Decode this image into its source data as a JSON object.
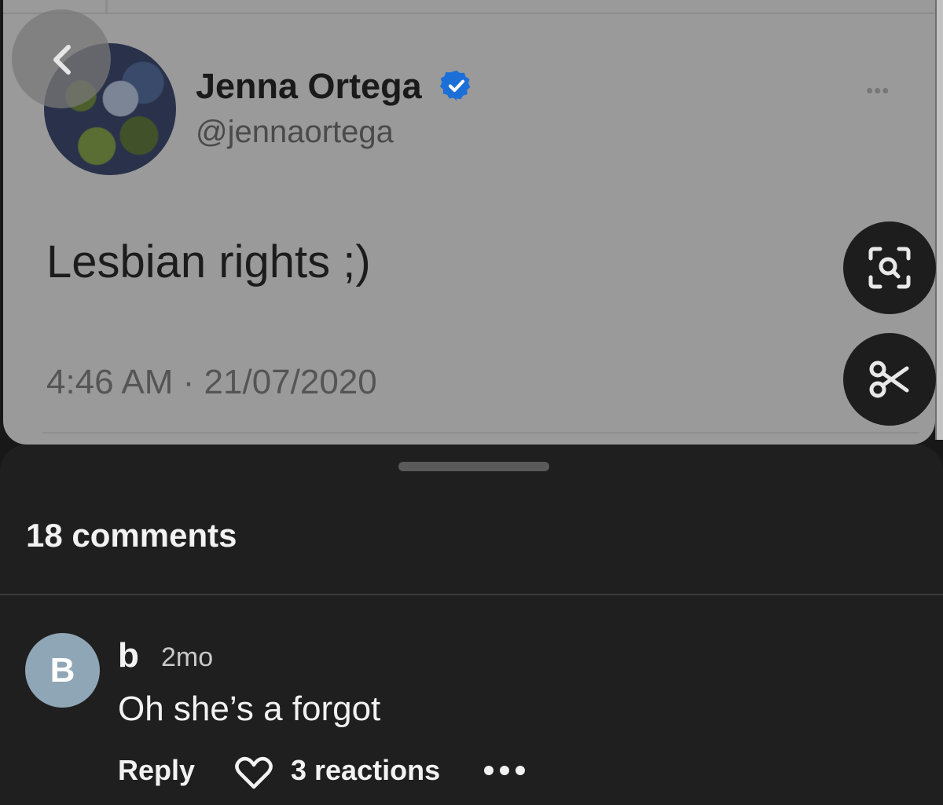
{
  "tweet": {
    "display_name": "Jenna Ortega",
    "handle": "@jennaortega",
    "text": "Lesbian rights ;)",
    "timestamp": "4:46 AM · 21/07/2020",
    "verified": true,
    "more_icon": "more-horizontal-icon",
    "more_glyph": "•••"
  },
  "overlay": {
    "back_icon": "chevron-left-icon",
    "lens_icon": "lens-search-icon",
    "scissors_icon": "scissors-icon"
  },
  "comments": {
    "count_label": "18 comments",
    "items": [
      {
        "avatar_initial": "B",
        "author": "b",
        "time": "2mo",
        "text": "Oh she’s a forgot",
        "reply_label": "Reply",
        "reactions_label": "3 reactions",
        "reaction_icon": "heart-icon",
        "more_icon": "more-horizontal-icon"
      }
    ]
  },
  "colors": {
    "verified_blue": "#1d6fd8",
    "sheet_background": "#1f1f1f",
    "avatar_background": "#8fa6b6"
  }
}
